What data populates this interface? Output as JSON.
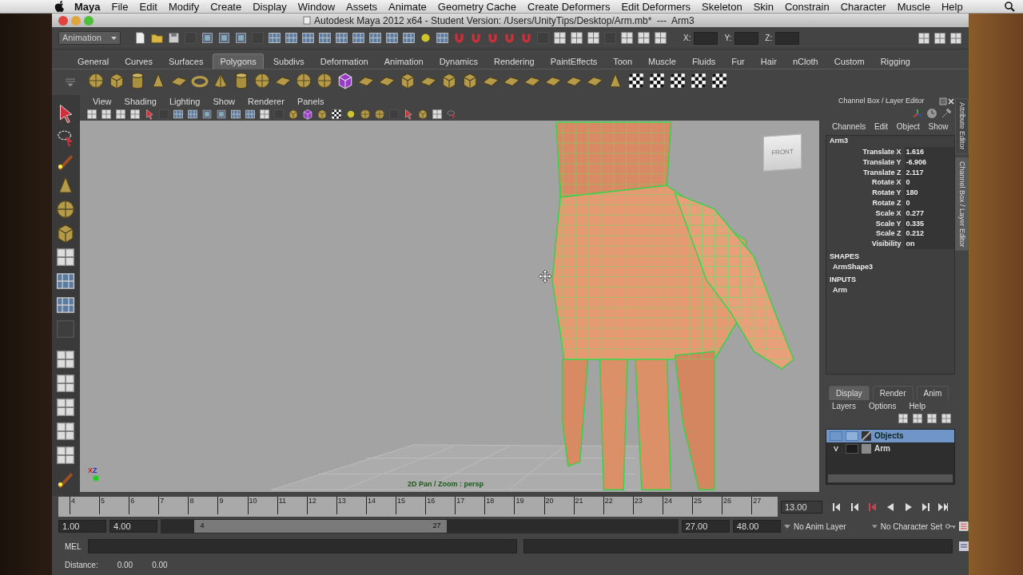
{
  "menubar": {
    "app": "Maya",
    "menus": [
      "File",
      "Edit",
      "Modify",
      "Create",
      "Display",
      "Window",
      "Assets",
      "Animate",
      "Geometry Cache",
      "Create Deformers",
      "Edit Deformers",
      "Skeleton",
      "Skin",
      "Constrain",
      "Character",
      "Muscle",
      "Help"
    ]
  },
  "window": {
    "title": "Autodesk Maya 2012 x64 - Student Version: /Users/UnityTips/Desktop/Arm.mb*  ---  Arm3"
  },
  "status_line": {
    "mode": "Animation",
    "coords": [
      "X:",
      "Y:",
      "Z:"
    ]
  },
  "shelf": {
    "tabs": [
      {
        "label": "General",
        "selected": false
      },
      {
        "label": "Curves",
        "selected": false
      },
      {
        "label": "Surfaces",
        "selected": false
      },
      {
        "label": "Polygons",
        "selected": true
      },
      {
        "label": "Subdivs",
        "selected": false
      },
      {
        "label": "Deformation",
        "selected": false
      },
      {
        "label": "Animation",
        "selected": false
      },
      {
        "label": "Dynamics",
        "selected": false
      },
      {
        "label": "Rendering",
        "selected": false
      },
      {
        "label": "PaintEffects",
        "selected": false
      },
      {
        "label": "Toon",
        "selected": false
      },
      {
        "label": "Muscle",
        "selected": false
      },
      {
        "label": "Fluids",
        "selected": false
      },
      {
        "label": "Fur",
        "selected": false
      },
      {
        "label": "Hair",
        "selected": false
      },
      {
        "label": "nCloth",
        "selected": false
      },
      {
        "label": "Custom",
        "selected": false
      },
      {
        "label": "Rigging",
        "selected": false
      }
    ]
  },
  "panel": {
    "menus": [
      "View",
      "Shading",
      "Lighting",
      "Show",
      "Renderer",
      "Panels"
    ],
    "view_cube": "FRONT",
    "axis_labels": [
      "X",
      "Z"
    ],
    "caption": "2D Pan / Zoom : persp"
  },
  "channel_box": {
    "title": "Channel Box / Layer Editor",
    "menus": [
      "Channels",
      "Edit",
      "Object",
      "Show"
    ],
    "node": "Arm3",
    "channels": [
      {
        "name": "Translate X",
        "value": "1.616"
      },
      {
        "name": "Translate Y",
        "value": "-6.906"
      },
      {
        "name": "Translate Z",
        "value": "2.117"
      },
      {
        "name": "Rotate X",
        "value": "0"
      },
      {
        "name": "Rotate Y",
        "value": "180"
      },
      {
        "name": "Rotate Z",
        "value": "0"
      },
      {
        "name": "Scale X",
        "value": "0.277"
      },
      {
        "name": "Scale Y",
        "value": "0.335"
      },
      {
        "name": "Scale Z",
        "value": "0.212"
      },
      {
        "name": "Visibility",
        "value": "on"
      }
    ],
    "sections": [
      {
        "heading": "SHAPES",
        "items": [
          "ArmShape3"
        ]
      },
      {
        "heading": "INPUTS",
        "items": [
          "Arm"
        ]
      }
    ]
  },
  "layer_editor": {
    "tabs": [
      {
        "label": "Display",
        "selected": true
      },
      {
        "label": "Render",
        "selected": false
      },
      {
        "label": "Anim",
        "selected": false
      }
    ],
    "menus": [
      "Layers",
      "Options",
      "Help"
    ],
    "layers": [
      {
        "name": "Objects",
        "kind": "root",
        "selected": true
      },
      {
        "name": "Arm",
        "kind": "layer",
        "visibility": "V",
        "selected": false
      }
    ]
  },
  "side_tabs": [
    {
      "label": "Attribute Editor",
      "selected": false
    },
    {
      "label": "Channel Box / Layer Editor",
      "selected": true
    }
  ],
  "timeline": {
    "ticks": [
      "4",
      "5",
      "6",
      "7",
      "8",
      "9",
      "10",
      "11",
      "12",
      "13",
      "14",
      "15",
      "16",
      "17",
      "18",
      "19",
      "20",
      "21",
      "22",
      "23",
      "24",
      "25",
      "26",
      "27"
    ],
    "current_frame": "13.00"
  },
  "range_slider": {
    "start": "1.00",
    "range_start": "4.00",
    "handle_start": "4",
    "handle_end": "27",
    "range_end": "27.00",
    "end": "48.00",
    "anim_layer": "No Anim Layer",
    "character_set": "No Character Set"
  },
  "command_line": {
    "label": "MEL"
  },
  "help_line": {
    "label": "Distance:",
    "values": [
      "0.00",
      "0.00"
    ]
  }
}
